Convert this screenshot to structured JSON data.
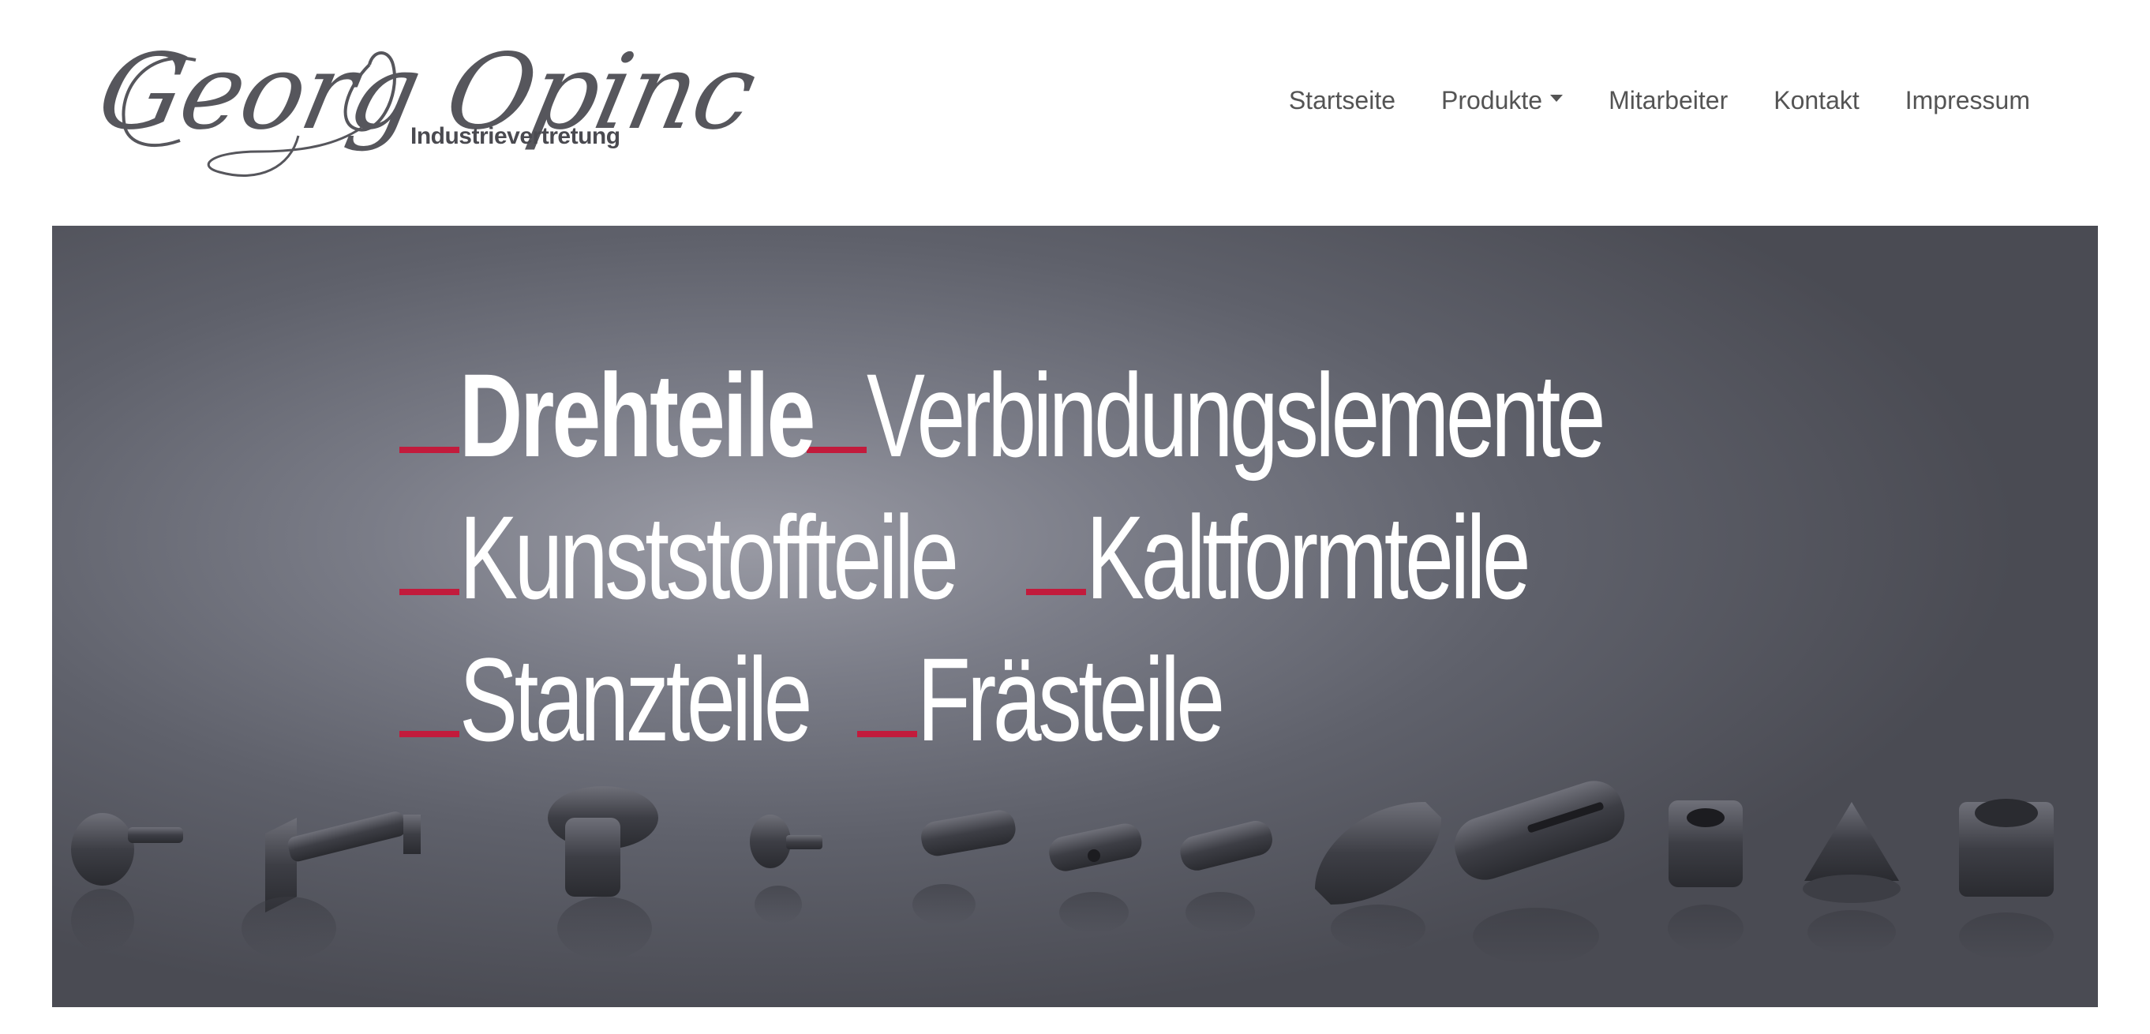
{
  "logo": {
    "script": "Georg Opinc",
    "subtitle": "Industrievertretung"
  },
  "nav": {
    "items": [
      {
        "label": "Startseite"
      },
      {
        "label": "Produkte",
        "dropdown": true
      },
      {
        "label": "Mitarbeiter"
      },
      {
        "label": "Kontakt"
      },
      {
        "label": "Impressum"
      }
    ]
  },
  "hero": {
    "accent_color": "#c21b3c",
    "lines": [
      [
        {
          "text": "Drehteile",
          "bold": true
        },
        {
          "text": "Verbindungslemente",
          "bold": false
        }
      ],
      [
        {
          "text": "Kunststoffteile",
          "bold": false
        },
        {
          "text": "Kaltformteile",
          "bold": false
        }
      ],
      [
        {
          "text": "Stanzteile",
          "bold": false
        },
        {
          "text": "Frästeile",
          "bold": false
        }
      ]
    ],
    "product_images": [
      "bevel-gear-part-icon",
      "threaded-bolt-icon",
      "flanged-fitting-icon",
      "small-screw-icon",
      "cylinder-pin-icon",
      "cross-hole-pin-icon",
      "slotted-pin-icon",
      "angled-nozzle-icon",
      "slotted-shaft-icon",
      "square-block-icon",
      "cone-fitting-icon",
      "hex-nut-fitting-icon"
    ]
  }
}
